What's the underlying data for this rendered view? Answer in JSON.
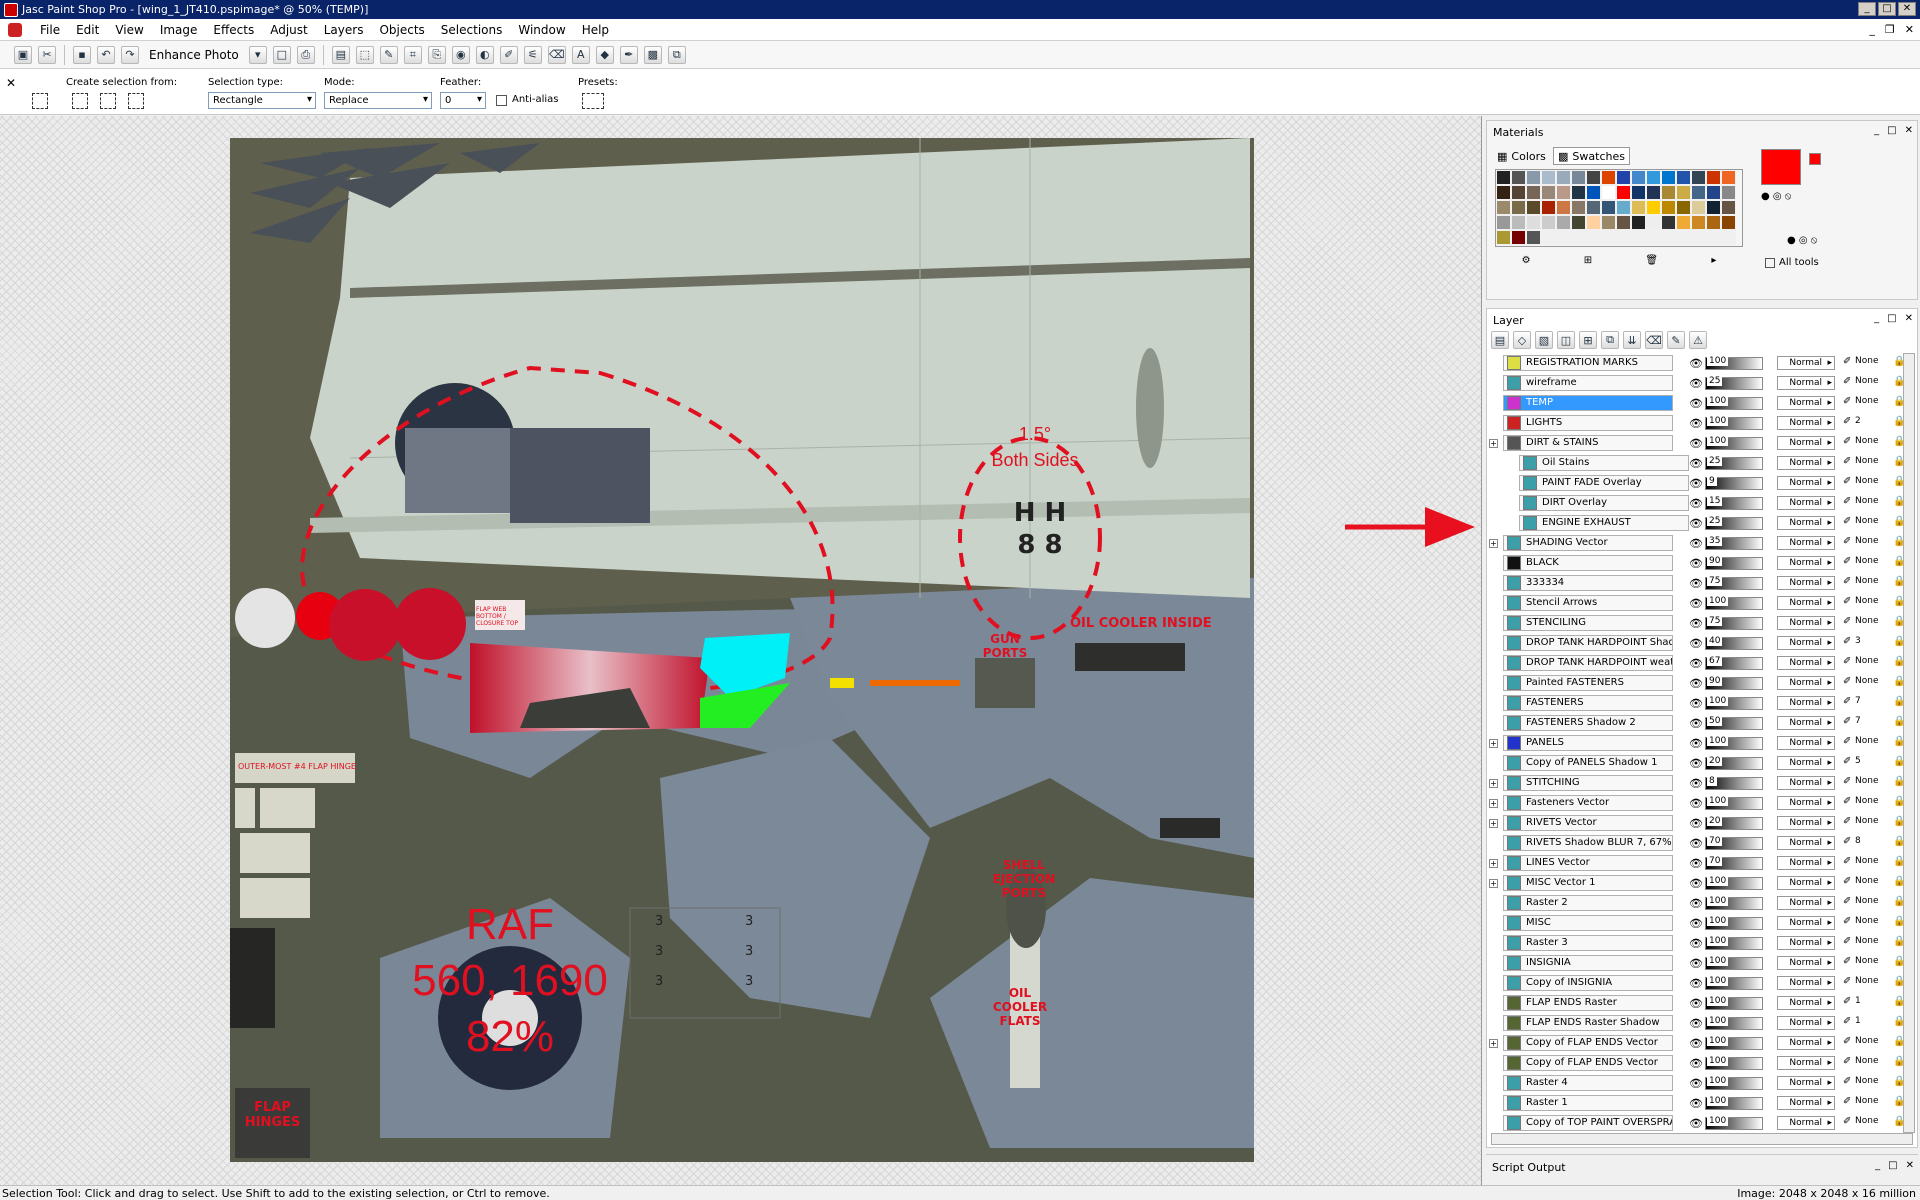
{
  "window": {
    "title": "Jasc Paint Shop Pro - [wing_1_JT410.pspimage* @  50% (TEMP)]"
  },
  "menu": [
    "File",
    "Edit",
    "View",
    "Image",
    "Effects",
    "Adjust",
    "Layers",
    "Objects",
    "Selections",
    "Window",
    "Help"
  ],
  "toolbar": {
    "enhance_photo": "Enhance Photo"
  },
  "tool_options": {
    "create_selection_from": "Create selection from:",
    "selection_type_label": "Selection type:",
    "selection_type": "Rectangle",
    "mode_label": "Mode:",
    "mode": "Replace",
    "feather_label": "Feather:",
    "feather": "0",
    "antialias": "Anti-alias",
    "presets": "Presets:"
  },
  "canvas": {
    "annotation_angle": "1.5°",
    "annotation_sides": "Both Sides",
    "oil_cooler_inside": "OIL COOLER INSIDE",
    "gun_ports": "GUN PORTS",
    "shell_ejection": "SHELL EJECTION PORTS",
    "oil_cooler_flats": "OIL COOLER FLATS",
    "flap_hinges": "FLAP HINGES",
    "raf": "RAF",
    "coords": "560, 1690",
    "percent": "82%",
    "outer_flap": "OUTER-MOST #4  FLAP HINGE",
    "flap_web": "FLAP WEB BOTTOM / CLOSURE TOP",
    "hh": "H H",
    "eights": "8 8",
    "labels_3": [
      "3",
      "3",
      "3",
      "3",
      "3",
      "3"
    ]
  },
  "materials": {
    "title": "Materials",
    "tab_colors": "Colors",
    "tab_swatches": "Swatches",
    "all_tools": "All tools",
    "swatches": [
      "#222222",
      "#555555",
      "#8899aa",
      "#aabbcc",
      "#99aabb",
      "#778899",
      "#444444",
      "#dd4400",
      "#2244aa",
      "#4488cc",
      "#3399dd",
      "#0077cc",
      "#2255aa",
      "#334455",
      "#cc3300",
      "#ee6622",
      "#332211",
      "#554433",
      "#776655",
      "#998877",
      "#bb9988",
      "#223344",
      "#0055bb",
      "#ffffff",
      "#ff0000",
      "#113366",
      "#223355",
      "#aa8833",
      "#ccaa44",
      "#446688",
      "#224488",
      "#888888",
      "#9a8a6a",
      "#7a6a4a",
      "#5a4a2a",
      "#aa2200",
      "#cc7744",
      "#887766",
      "#556677",
      "#335577",
      "#66aacc",
      "#ddbb55",
      "#ffcc00",
      "#bb8800",
      "#886600",
      "#ddcc99",
      "#112233",
      "#665544",
      "#999999",
      "#bbbbbb",
      "#dddddd",
      "#cccccc",
      "#aaaaaa",
      "#444433",
      "#ffd0a0",
      "#998866",
      "#665544",
      "#222222",
      "#eeeeee",
      "#333333",
      "#eeaa33",
      "#cc8822",
      "#aa6611",
      "#884400",
      "#aa9933",
      "#770000",
      "#555555",
      "#f0f0f0",
      "#f0f0f0",
      "#f0f0f0",
      "#f0f0f0",
      "#f0f0f0",
      "#f0f0f0",
      "#f0f0f0",
      "#f0f0f0",
      "#f0f0f0",
      "#f0f0f0",
      "#f0f0f0",
      "#f0f0f0",
      "#f0f0f0"
    ],
    "foreground": "#ff0000",
    "background": "#ff0000"
  },
  "layers": {
    "title": "Layer",
    "rows": [
      {
        "name": "REGISTRATION MARKS",
        "opacity": "100",
        "mode": "Normal",
        "mask": "None",
        "thumb": "#dddd44",
        "indent": 0,
        "exp": false
      },
      {
        "name": "wireframe",
        "opacity": "25",
        "mode": "Normal",
        "mask": "None",
        "thumb": "#3b9ea8",
        "indent": 0,
        "exp": false
      },
      {
        "name": "TEMP",
        "opacity": "100",
        "mode": "Normal",
        "mask": "None",
        "thumb": "#cc33cc",
        "indent": 0,
        "exp": false,
        "selected": true
      },
      {
        "name": "LIGHTS",
        "opacity": "100",
        "mode": "Normal",
        "mask": "2",
        "thumb": "#cc2222",
        "indent": 0,
        "exp": false
      },
      {
        "name": "DIRT & STAINS",
        "opacity": "100",
        "mode": "Normal",
        "mask": "None",
        "thumb": "#555555",
        "indent": 0,
        "exp": true
      },
      {
        "name": "Oil Stains",
        "opacity": "25",
        "mode": "Normal",
        "mask": "None",
        "thumb": "#3b9ea8",
        "indent": 1,
        "exp": false
      },
      {
        "name": "PAINT FADE Overlay",
        "opacity": "9",
        "mode": "Normal",
        "mask": "None",
        "thumb": "#3b9ea8",
        "indent": 1,
        "exp": false
      },
      {
        "name": "DIRT Overlay",
        "opacity": "15",
        "mode": "Normal",
        "mask": "None",
        "thumb": "#3b9ea8",
        "indent": 1,
        "exp": false
      },
      {
        "name": "ENGINE EXHAUST",
        "opacity": "25",
        "mode": "Normal",
        "mask": "None",
        "thumb": "#3b9ea8",
        "indent": 1,
        "exp": false
      },
      {
        "name": "SHADING Vector",
        "opacity": "35",
        "mode": "Normal",
        "mask": "None",
        "thumb": "#3b9ea8",
        "indent": 0,
        "exp": true
      },
      {
        "name": "BLACK",
        "opacity": "90",
        "mode": "Normal",
        "mask": "None",
        "thumb": "#111111",
        "indent": 0,
        "exp": false
      },
      {
        "name": "333334",
        "opacity": "75",
        "mode": "Normal",
        "mask": "None",
        "thumb": "#3b9ea8",
        "indent": 0,
        "exp": false
      },
      {
        "name": "Stencil Arrows",
        "opacity": "100",
        "mode": "Normal",
        "mask": "None",
        "thumb": "#3b9ea8",
        "indent": 0,
        "exp": false
      },
      {
        "name": "STENCILING",
        "opacity": "75",
        "mode": "Normal",
        "mask": "None",
        "thumb": "#3b9ea8",
        "indent": 0,
        "exp": false
      },
      {
        "name": "DROP TANK HARDPOINT Shado",
        "opacity": "40",
        "mode": "Normal",
        "mask": "3",
        "thumb": "#3b9ea8",
        "indent": 0,
        "exp": false
      },
      {
        "name": "DROP TANK HARDPOINT weath",
        "opacity": "67",
        "mode": "Normal",
        "mask": "None",
        "thumb": "#3b9ea8",
        "indent": 0,
        "exp": false
      },
      {
        "name": "Painted FASTENERS",
        "opacity": "90",
        "mode": "Normal",
        "mask": "None",
        "thumb": "#3b9ea8",
        "indent": 0,
        "exp": false
      },
      {
        "name": "FASTENERS",
        "opacity": "100",
        "mode": "Normal",
        "mask": "7",
        "thumb": "#3b9ea8",
        "indent": 0,
        "exp": false
      },
      {
        "name": "FASTENERS Shadow 2",
        "opacity": "50",
        "mode": "Normal",
        "mask": "7",
        "thumb": "#3b9ea8",
        "indent": 0,
        "exp": false
      },
      {
        "name": "PANELS",
        "opacity": "100",
        "mode": "Normal",
        "mask": "None",
        "thumb": "#2233cc",
        "indent": 0,
        "exp": true
      },
      {
        "name": "Copy of PANELS Shadow 1",
        "opacity": "20",
        "mode": "Normal",
        "mask": "5",
        "thumb": "#3b9ea8",
        "indent": 0,
        "exp": false
      },
      {
        "name": "STITCHING",
        "opacity": "8",
        "mode": "Normal",
        "mask": "None",
        "thumb": "#3b9ea8",
        "indent": 0,
        "exp": true
      },
      {
        "name": "Fasteners Vector",
        "opacity": "100",
        "mode": "Normal",
        "mask": "None",
        "thumb": "#3b9ea8",
        "indent": 0,
        "exp": true
      },
      {
        "name": "RIVETS Vector",
        "opacity": "20",
        "mode": "Normal",
        "mask": "None",
        "thumb": "#3b9ea8",
        "indent": 0,
        "exp": true
      },
      {
        "name": "RIVETS Shadow BLUR 7, 67%",
        "opacity": "70",
        "mode": "Normal",
        "mask": "8",
        "thumb": "#3b9ea8",
        "indent": 0,
        "exp": false
      },
      {
        "name": "LINES Vector",
        "opacity": "70",
        "mode": "Normal",
        "mask": "None",
        "thumb": "#3b9ea8",
        "indent": 0,
        "exp": true
      },
      {
        "name": "MISC Vector 1",
        "opacity": "100",
        "mode": "Normal",
        "mask": "None",
        "thumb": "#3b9ea8",
        "indent": 0,
        "exp": true
      },
      {
        "name": "Raster 2",
        "opacity": "100",
        "mode": "Normal",
        "mask": "None",
        "thumb": "#3b9ea8",
        "indent": 0,
        "exp": false
      },
      {
        "name": "MISC",
        "opacity": "100",
        "mode": "Normal",
        "mask": "None",
        "thumb": "#3b9ea8",
        "indent": 0,
        "exp": false
      },
      {
        "name": "Raster 3",
        "opacity": "100",
        "mode": "Normal",
        "mask": "None",
        "thumb": "#3b9ea8",
        "indent": 0,
        "exp": false
      },
      {
        "name": "INSIGNIA",
        "opacity": "100",
        "mode": "Normal",
        "mask": "None",
        "thumb": "#3b9ea8",
        "indent": 0,
        "exp": false
      },
      {
        "name": "Copy of INSIGNIA",
        "opacity": "100",
        "mode": "Normal",
        "mask": "None",
        "thumb": "#3b9ea8",
        "indent": 0,
        "exp": false
      },
      {
        "name": "FLAP ENDS Raster",
        "opacity": "100",
        "mode": "Normal",
        "mask": "1",
        "thumb": "#556633",
        "indent": 0,
        "exp": false
      },
      {
        "name": "FLAP ENDS Raster Shadow",
        "opacity": "100",
        "mode": "Normal",
        "mask": "1",
        "thumb": "#556633",
        "indent": 0,
        "exp": false
      },
      {
        "name": "Copy of FLAP ENDS Vector",
        "opacity": "100",
        "mode": "Normal",
        "mask": "None",
        "thumb": "#556633",
        "indent": 0,
        "exp": true
      },
      {
        "name": "Copy of FLAP ENDS Vector",
        "opacity": "100",
        "mode": "Normal",
        "mask": "None",
        "thumb": "#556633",
        "indent": 0,
        "exp": false
      },
      {
        "name": "Raster 4",
        "opacity": "100",
        "mode": "Normal",
        "mask": "None",
        "thumb": "#3b9ea8",
        "indent": 0,
        "exp": false
      },
      {
        "name": "Raster 1",
        "opacity": "100",
        "mode": "Normal",
        "mask": "None",
        "thumb": "#3b9ea8",
        "indent": 0,
        "exp": false
      },
      {
        "name": "Copy of TOP PAINT OVERSPRA",
        "opacity": "100",
        "mode": "Normal",
        "mask": "None",
        "thumb": "#3b9ea8",
        "indent": 0,
        "exp": false
      }
    ]
  },
  "script_output": "Script Output",
  "status": {
    "left": "Selection Tool: Click and drag to select. Use Shift to add to the existing selection, or Ctrl to remove.",
    "right": "Image:  2048 x 2048 x 16 million"
  }
}
